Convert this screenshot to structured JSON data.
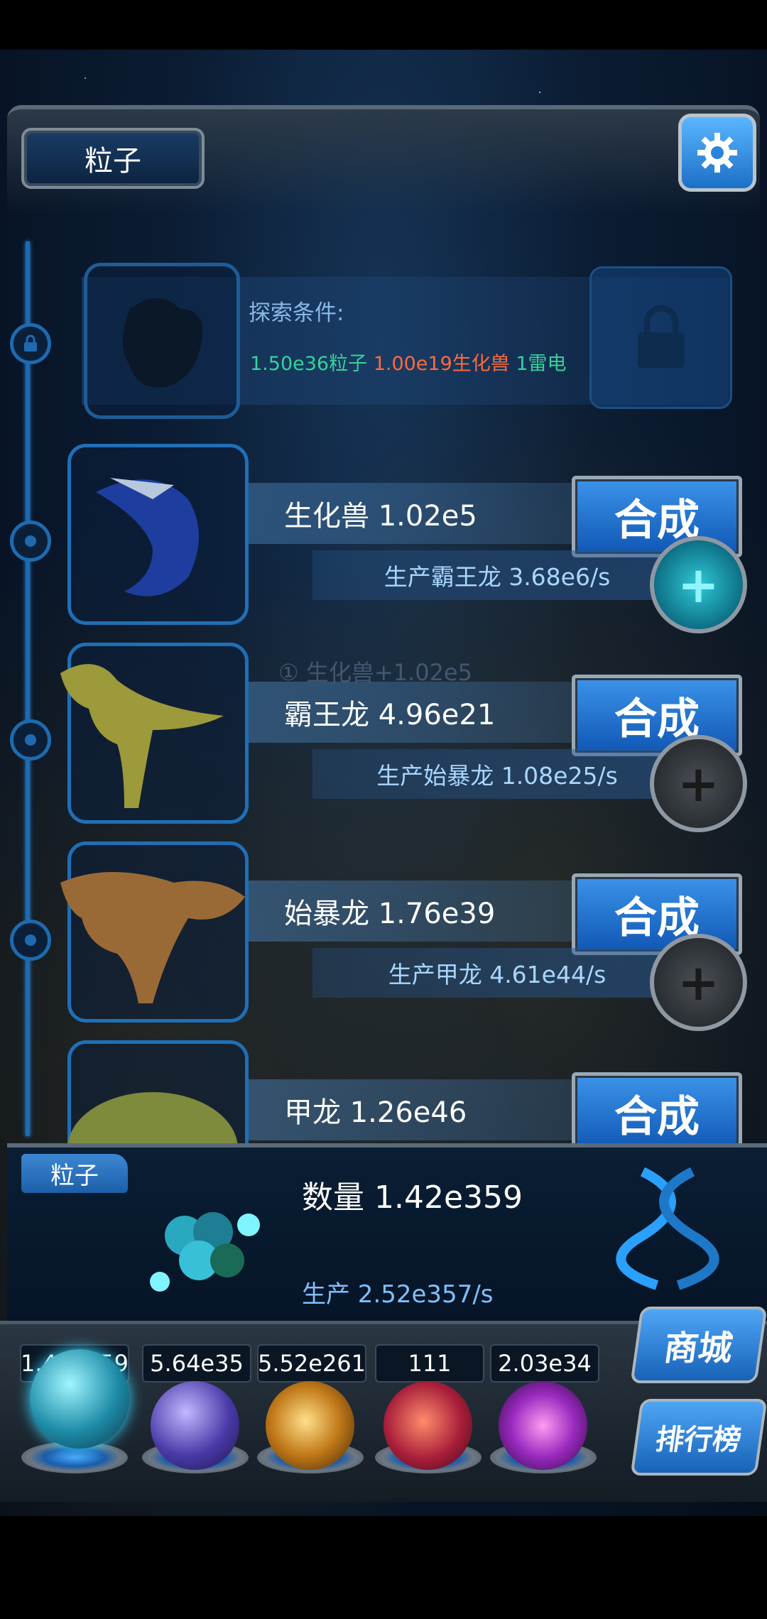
{
  "header": {
    "tab_label": "粒子",
    "settings_icon": "gear-icon"
  },
  "locked": {
    "title": "探索条件:",
    "cond_particles": "1.50e36粒子",
    "cond_creature": "1.00e19生化兽",
    "cond_thunder": "1雷电",
    "lock_icon": "lock-icon"
  },
  "creatures": [
    {
      "name": "生化兽 1.02e5",
      "button": "合成",
      "production": "生产霸王龙 3.68e6/s",
      "plus": "+",
      "active": true
    },
    {
      "name": "霸王龙 4.96e21",
      "button": "合成",
      "production": "生产始暴龙 1.08e25/s",
      "plus": "+",
      "active": false
    },
    {
      "name": "始暴龙 1.76e39",
      "button": "合成",
      "production": "生产甲龙 4.61e44/s",
      "plus": "+",
      "active": false
    },
    {
      "name": "甲龙 1.26e46",
      "button": "合成"
    }
  ],
  "floating_text": "① 生化兽+1.02e5",
  "status": {
    "tab_label": "粒子",
    "count": "数量 1.42e359",
    "production": "生产 2.52e357/s"
  },
  "resources": [
    {
      "value": "1.42e359",
      "orb": "particle-orb"
    },
    {
      "value": "5.64e35",
      "orb": "thunder-orb"
    },
    {
      "value": "5.52e261",
      "orb": "fire-orb"
    },
    {
      "value": "111",
      "orb": "brain-orb"
    },
    {
      "value": "2.03e34",
      "orb": "vortex-orb"
    }
  ],
  "side_buttons": {
    "shop": "商城",
    "ranking": "排行榜"
  },
  "colors": {
    "accent": "#1f6fb6",
    "cond_green": "#34d39a",
    "cond_red": "#ff6a3d"
  }
}
